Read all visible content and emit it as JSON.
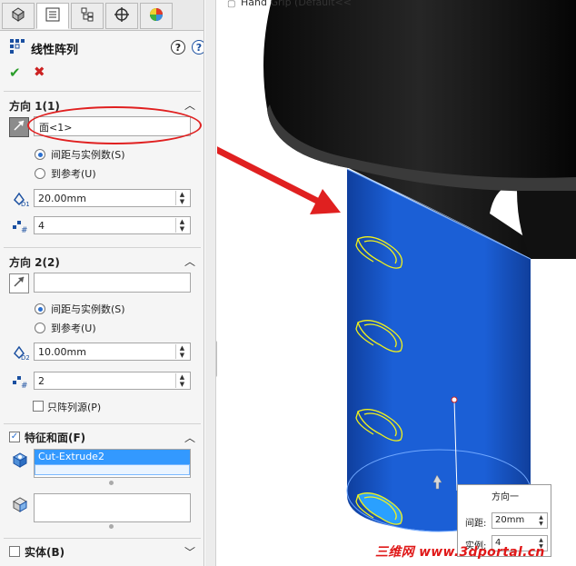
{
  "tabs": [
    {
      "icon": "feature-manager-icon",
      "active": false
    },
    {
      "icon": "property-manager-icon",
      "active": true
    },
    {
      "icon": "configuration-manager-icon",
      "active": false
    },
    {
      "icon": "dimxpert-manager-icon",
      "active": false
    },
    {
      "icon": "display-manager-icon",
      "active": false
    }
  ],
  "feature": {
    "title": "线性阵列",
    "help_glyph": "?",
    "ok_glyph": "✔",
    "cancel_glyph": "✖"
  },
  "direction1": {
    "heading": "方向 1(1)",
    "reference": "面<1>",
    "radio_spacing": "间距与实例数(S)",
    "radio_reference": "到参考(U)",
    "selected_radio": "spacing",
    "spacing": "20.00mm",
    "instances": "4"
  },
  "direction2": {
    "heading": "方向 2(2)",
    "reference": "",
    "radio_spacing": "间距与实例数(S)",
    "radio_reference": "到参考(U)",
    "selected_radio": "spacing",
    "spacing": "10.00mm",
    "instances": "2",
    "seed_only_label": "只阵列源(P)",
    "seed_only_checked": false
  },
  "features_faces": {
    "heading": "特征和面(F)",
    "checked": true,
    "features": [
      "Cut-Extrude2"
    ],
    "faces": []
  },
  "bodies": {
    "heading": "实体(B)",
    "checked": false
  },
  "viewport": {
    "tree_label": "Hand Grip  (Default<<",
    "part_color": "#1b5fd6",
    "top_color": "#141414",
    "sketch_color": "#f2f21a"
  },
  "callout": {
    "title": "方向一",
    "spacing_label": "间距:",
    "spacing_value": "20mm",
    "instances_label": "实例:",
    "instances_value": "4"
  },
  "watermark": "三维网 www.3dportal.cn",
  "colors": {
    "annotation_red": "#e02020",
    "selection_blue": "#3399ff"
  }
}
